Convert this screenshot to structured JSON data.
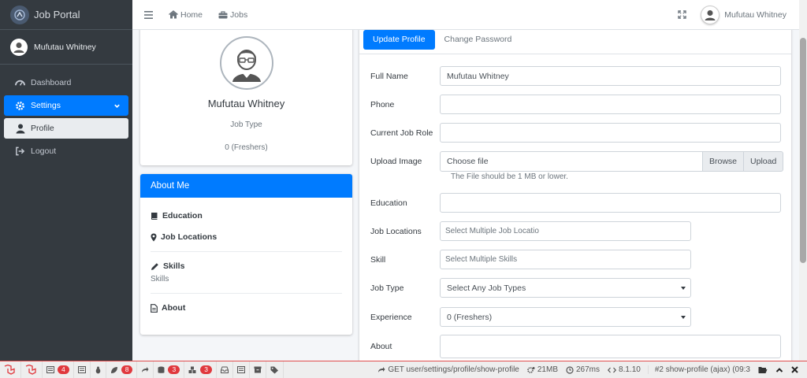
{
  "brand": {
    "name": "Job Portal"
  },
  "sidebar": {
    "user_name": "Mufutau Whitney",
    "items": [
      {
        "label": "Dashboard",
        "icon": "tachometer-icon"
      },
      {
        "label": "Settings",
        "icon": "gear-icon"
      },
      {
        "label": "Profile",
        "icon": "user-icon"
      },
      {
        "label": "Logout",
        "icon": "sign-out-icon"
      }
    ]
  },
  "topbar": {
    "home_label": "Home",
    "jobs_label": "Jobs",
    "user_name": "Mufutau Whitney"
  },
  "profile_card": {
    "name": "Mufutau Whitney",
    "job_type": "Job Type",
    "experience": "0 (Freshers)"
  },
  "about": {
    "title": "About Me",
    "education": "Education",
    "job_locations": "Job Locations",
    "skills": "Skills",
    "skills_value": "Skills",
    "about_label": "About"
  },
  "tabs": {
    "update": "Update Profile",
    "change_password": "Change Password"
  },
  "form": {
    "full_name": {
      "label": "Full Name",
      "value": "Mufutau Whitney"
    },
    "phone": {
      "label": "Phone",
      "value": ""
    },
    "current_job_role": {
      "label": "Current Job Role",
      "value": ""
    },
    "upload_image": {
      "label": "Upload Image",
      "placeholder": "Choose file",
      "browse": "Browse",
      "upload": "Upload",
      "hint": "The File should be 1 MB or lower."
    },
    "education": {
      "label": "Education",
      "value": ""
    },
    "job_locations": {
      "label": "Job Locations",
      "placeholder": "Select Multiple Job Locatio"
    },
    "skill": {
      "label": "Skill",
      "placeholder": "Select Multiple Skills"
    },
    "job_type": {
      "label": "Job Type",
      "selected": "Select Any Job Types"
    },
    "experience": {
      "label": "Experience",
      "selected": "0 (Freshers)"
    },
    "about": {
      "label": "About",
      "value": ""
    }
  },
  "debugbar": {
    "badges": [
      "4",
      "8",
      "3",
      "3"
    ],
    "request": "GET user/settings/profile/show-profile",
    "memory": "21MB",
    "time": "267ms",
    "php": "8.1.10",
    "ajax": "#2 show-profile (ajax) (09:3"
  },
  "colors": {
    "primary": "#007bff",
    "sidebar": "#343a40",
    "debug_badge": "#e0393e"
  }
}
